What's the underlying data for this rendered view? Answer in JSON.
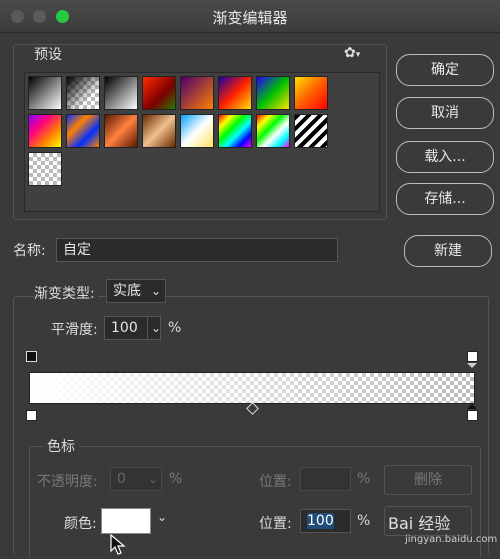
{
  "window": {
    "title": "渐变编辑器"
  },
  "presets": {
    "label": "预设",
    "swatches": [
      "linear-gradient(135deg,#000,#fff)",
      "checker-black",
      "linear-gradient(135deg,#000,#fff)",
      "linear-gradient(135deg,#ff2a00,#7a0000 60%,#2a7a00)",
      "linear-gradient(135deg,#4a0070,#ff8000)",
      "linear-gradient(135deg,#1a00a0,#ff2000,#ffe000)",
      "linear-gradient(135deg,#2000ff,#00c000,#ffe000)",
      "linear-gradient(135deg,#ffe000,#ff6000,#ff0000)",
      "linear-gradient(135deg,#8a00ff,#ff0080,#ff8000,#ffff00)",
      "linear-gradient(135deg,#0030ff,#ff8000,#0030ff,#ff8000)",
      "linear-gradient(135deg,#5a1800,#ff8040,#5a1800)",
      "linear-gradient(135deg,#6a2a00,#f0c090,#6a2a00)",
      "linear-gradient(135deg,#00a0ff,#ffffff,#ffe060)",
      "linear-gradient(135deg,#ff0000,#ffff00,#00ff00,#00ffff,#0000ff,#ff00ff)",
      "linear-gradient(135deg,#ff0000,#ffff00,#00ff00,#ffffff,#00ffff,#ff00ff)",
      "repeating-linear-gradient(135deg,#000 0 4px,#fff 4px 8px)",
      "checker"
    ]
  },
  "buttons": {
    "ok": "确定",
    "cancel": "取消",
    "load": "载入...",
    "save": "存储...",
    "new": "新建",
    "delete": "删除"
  },
  "name": {
    "label": "名称:",
    "value": "自定"
  },
  "gradient": {
    "type_label": "渐变类型:",
    "type_value": "实底",
    "smooth_label": "平滑度:",
    "smooth_value": "100",
    "smooth_unit": "%"
  },
  "stops": {
    "label": "色标",
    "opacity_label": "不透明度:",
    "opacity_value": "0",
    "opacity_unit": "%",
    "opacity_location_label": "位置:",
    "opacity_location_unit": "%",
    "color_label": "颜色:",
    "color_location_label": "位置:",
    "color_location_value": "100",
    "color_location_unit": "%",
    "color_value": "#ffffff"
  },
  "watermark": {
    "line1": "Bai 经验",
    "line2": "jingyan.baidu.com"
  }
}
